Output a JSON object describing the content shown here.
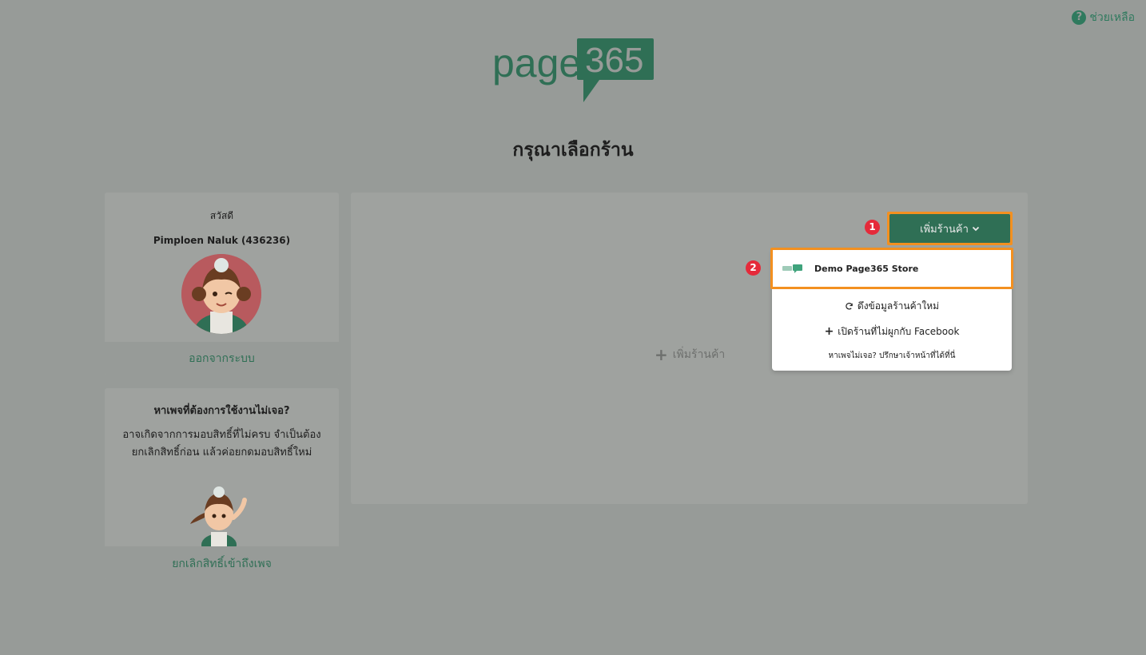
{
  "header": {
    "help_label": "ช่วยเหลือ",
    "logo_text_page": "page",
    "logo_text_365": "365"
  },
  "page": {
    "title": "กรุณาเลือกร้าน"
  },
  "user_card": {
    "greeting": "สวัสดี",
    "username": "Pimploen Naluk (436236)",
    "logout_label": "ออกจากระบบ"
  },
  "help_card": {
    "title": "หาเพจที่ต้องการใช้งานไม่เจอ?",
    "body_line1": "อาจเกิดจากการมอบสิทธิ์ที่ไม่ครบ จำเป็นต้อง",
    "body_line2": "ยกเลิกสิทธิ์ก่อน แล้วค่อยกดมอบสิทธิ์ใหม่",
    "revoke_label": "ยกเลิกสิทธิ์เข้าถึงเพจ"
  },
  "main": {
    "add_store_label": "เพิ่มร้านค้า",
    "add_store_button_label": "เพิ่มร้านค้า",
    "dropdown": {
      "store_name": "Demo Page365 Store",
      "refresh_label": "ดึงข้อมูลร้านค้าใหม่",
      "open_label": "เปิดร้านที่ไม่ผูกกับ Facebook",
      "not_found_label": "หาเพจไม่เจอ? ปรึกษาเจ้าหน้าที่ได้ที่นี่"
    }
  },
  "annotations": {
    "badge_1": "1",
    "badge_2": "2",
    "highlight_color": "#f39020",
    "badge_color": "#e52a3a"
  },
  "colors": {
    "brand_green": "#2f6f55",
    "overlay_bg": "#979b98",
    "card_bg": "#9fa29f"
  }
}
